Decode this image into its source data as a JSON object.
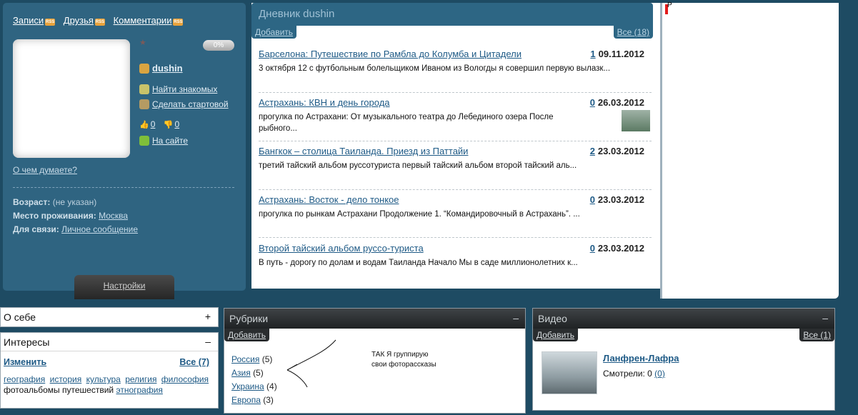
{
  "profile": {
    "top_links": [
      {
        "label": "Записи",
        "icon": "rss-icon"
      },
      {
        "label": "Друзья",
        "icon": "rss-icon"
      },
      {
        "label": "Комментарии",
        "icon": "rss-icon"
      }
    ],
    "progress": "0%",
    "username": "dushin",
    "find_friends": "Найти знакомых",
    "make_home": "Сделать стартовой",
    "likes": "0",
    "dislikes": "0",
    "online": "На сайте",
    "thinking": "О чем думаете?",
    "age_label": "Возраст:",
    "age_value": "(не указан)",
    "residence_label": "Место проживания:",
    "residence_value": "Москва",
    "contact_label": "Для связи:",
    "contact_value": "Личное сообщение",
    "settings": "Настройки"
  },
  "diary": {
    "title": "Дневник dushin",
    "add": "Добавить",
    "all": "Все (18)",
    "entries": [
      {
        "title": "Барселона: Путешествие по Рамбла до Колумба и Цитадели",
        "count": "1",
        "date": "09.11.2012",
        "text": "3 октября 12 с футбольным болельщиком Иваном из Вологды я совершил первую вылазк..."
      },
      {
        "title": "Астрахань: КВН и день города",
        "count": "0",
        "date": "26.03.2012",
        "text": "прогулка по Астрахани: От музыкального театра до Лебединого озера После рыбного..."
      },
      {
        "title": "Бангкок – столица Таиланда. Приезд из Паттайи",
        "count": "2",
        "date": "23.03.2012",
        "text": "третий тайский альбом руссотуриста первый тайский альбом второй тайский аль..."
      },
      {
        "title": "Астрахань: Восток - дело тонкое",
        "count": "0",
        "date": "23.03.2012",
        "text": "прогулка по рынкам Астрахани Продолжение 1. “Командировочный в Астрахань”. ..."
      },
      {
        "title": "Второй тайский альбом руссо-туриста",
        "count": "0",
        "date": "23.03.2012",
        "text": "В путь - дорогу по долам и водам Таиланда Начало Мы в саде миллионолетних к..."
      }
    ]
  },
  "right_marker": "P",
  "about": {
    "title": "О себе",
    "toggle": "+"
  },
  "interests": {
    "title": "Интересы",
    "toggle": "–",
    "edit": "Изменить",
    "all": "Все (7)",
    "tags": [
      "география",
      "история",
      "культура",
      "религия",
      "философия"
    ],
    "plain_tag": "фотоальбомы путешествий",
    "last_tag": "этнография"
  },
  "rubrics": {
    "title": "Рубрики",
    "toggle": "–",
    "add": "Добавить",
    "items": [
      {
        "name": "Россия",
        "count": "(5)"
      },
      {
        "name": "Азия",
        "count": "(5)"
      },
      {
        "name": "Украина",
        "count": "(4)"
      },
      {
        "name": "Европа",
        "count": "(3)"
      }
    ],
    "note_line1": "ТАК Я группирую",
    "note_line2": "свои фоторассказы"
  },
  "video": {
    "title": "Видео",
    "toggle": "–",
    "add": "Добавить",
    "all": "Все (1)",
    "item_title": "Ланфрен-Лафра",
    "views_label": "Смотрели: 0",
    "views_link": "(0)"
  }
}
